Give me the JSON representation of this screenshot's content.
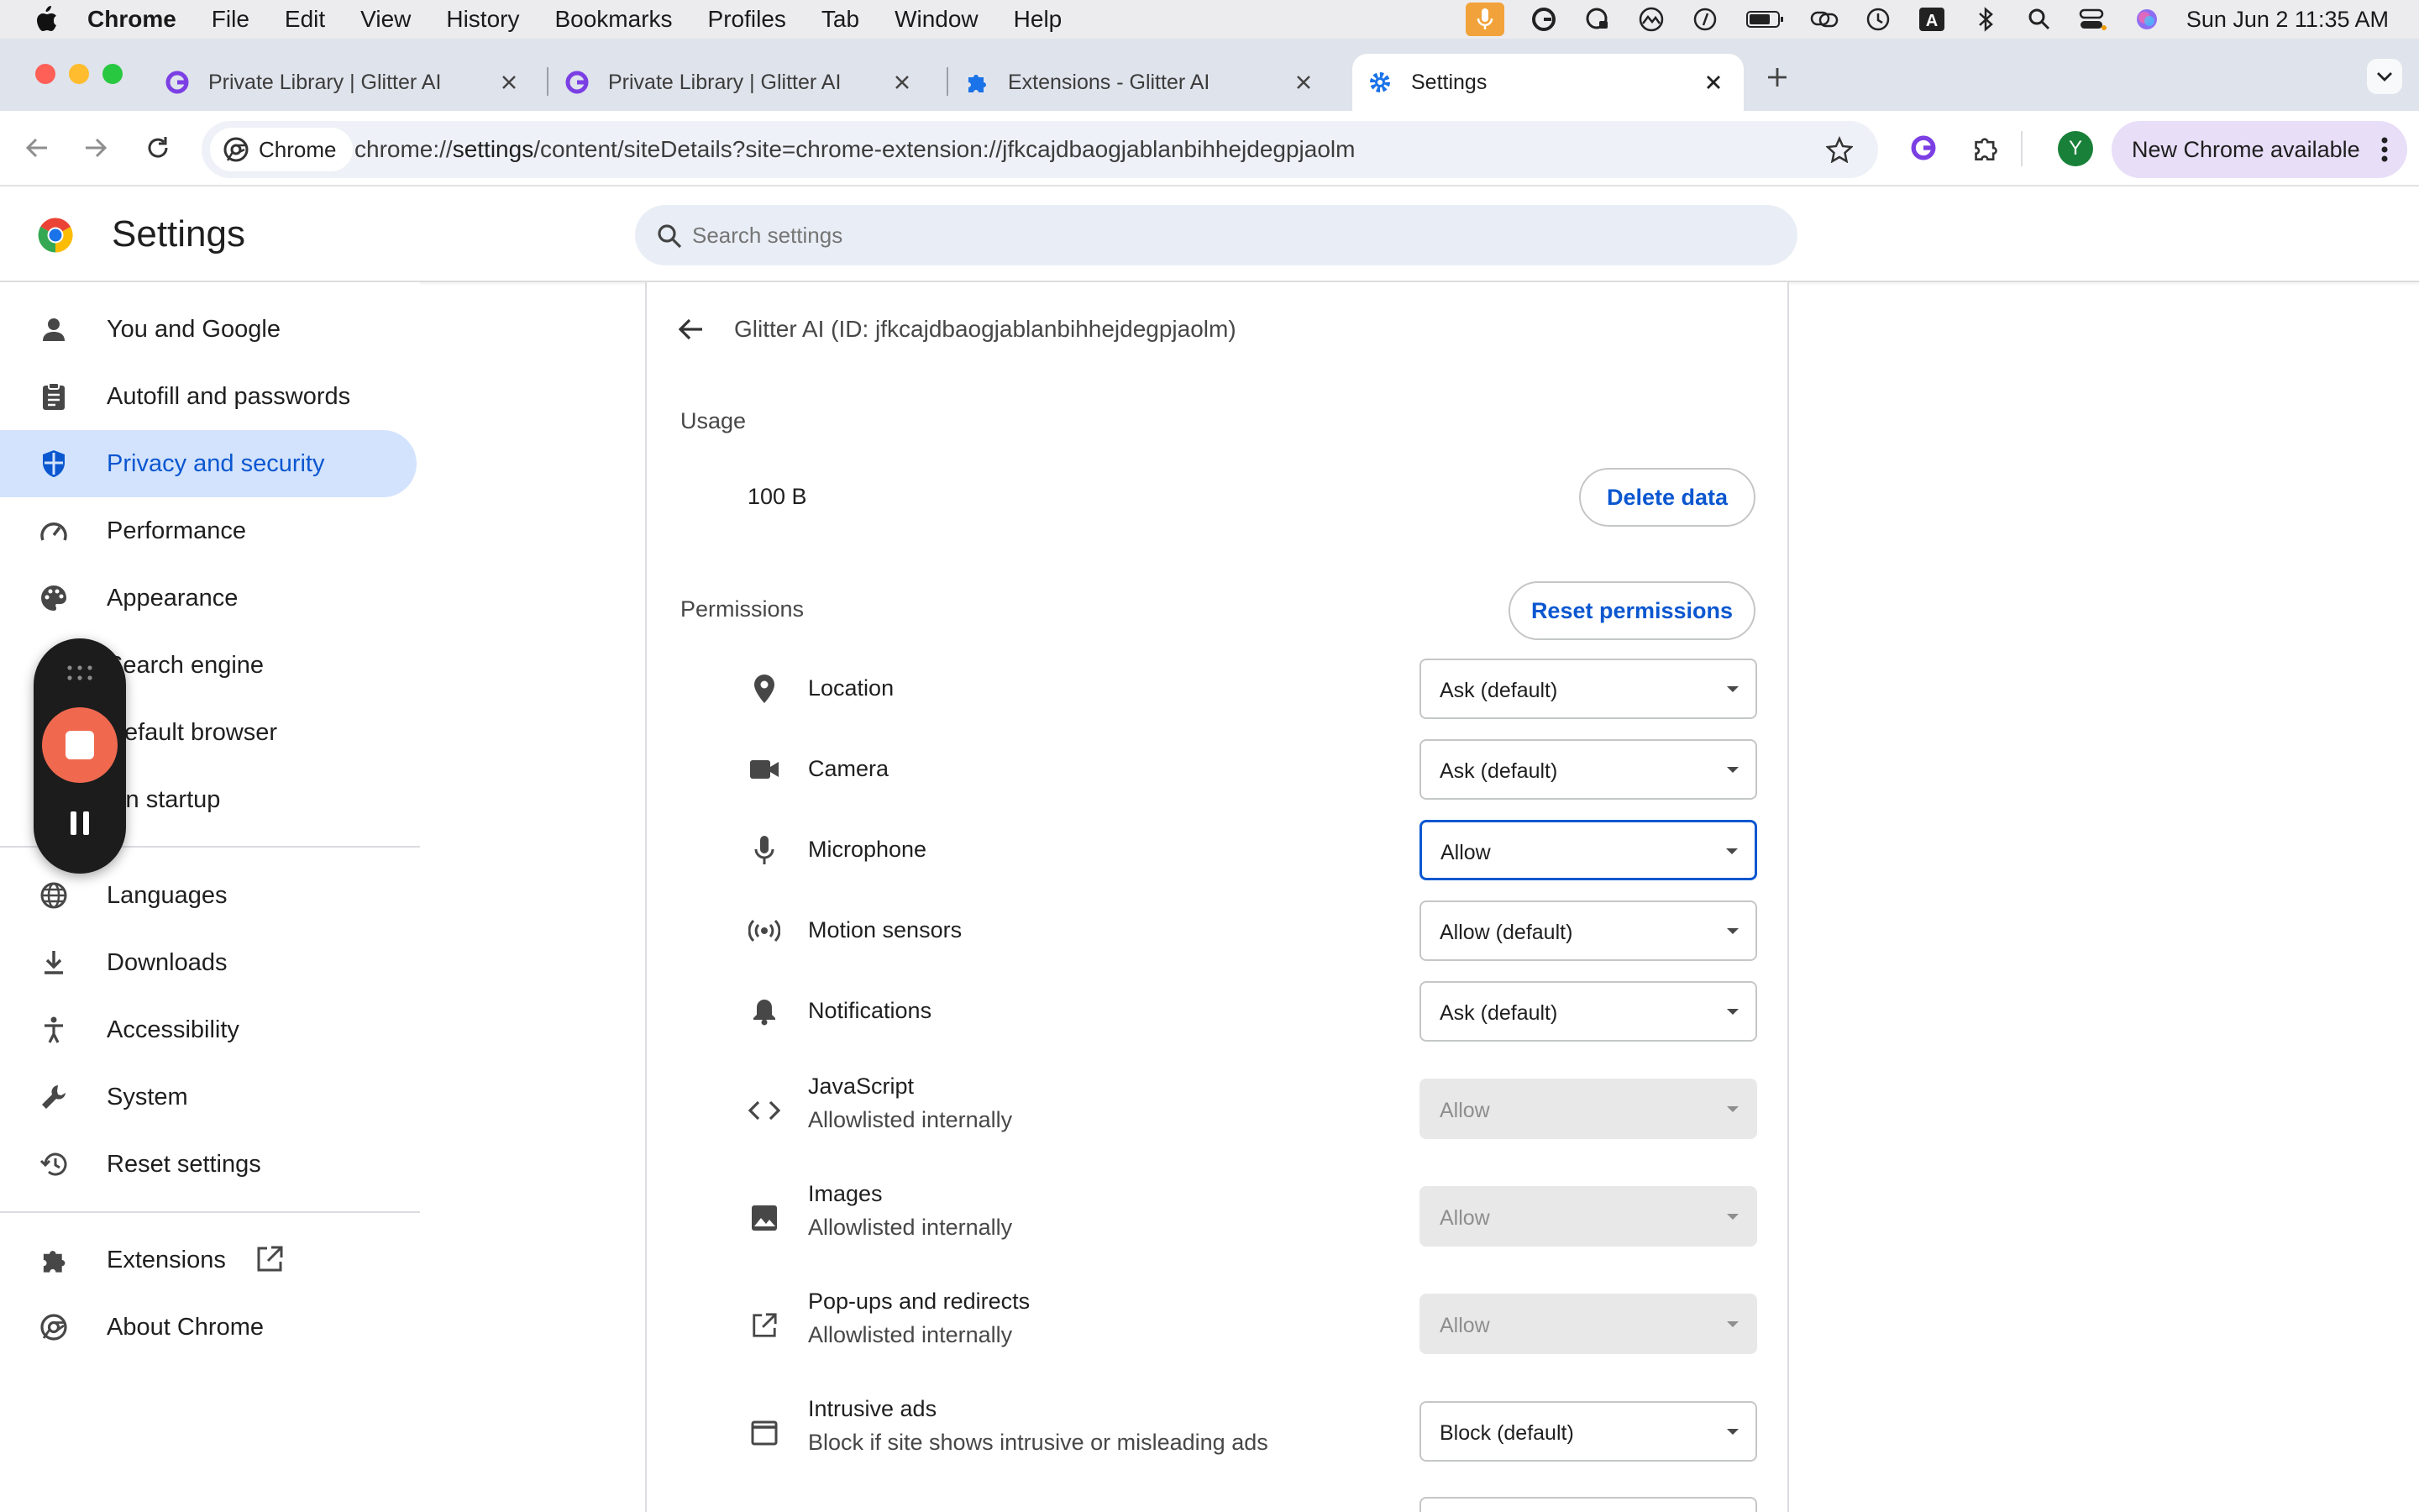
{
  "menubar": {
    "app_name": "Chrome",
    "items": [
      "File",
      "Edit",
      "View",
      "History",
      "Bookmarks",
      "Profiles",
      "Tab",
      "Window",
      "Help"
    ],
    "clock": "Sun Jun 2  11:35 AM"
  },
  "tabs": [
    {
      "title": "Private Library | Glitter AI",
      "icon": "glitter-icon"
    },
    {
      "title": "Private Library | Glitter AI",
      "icon": "glitter-icon"
    },
    {
      "title": "Extensions - Glitter AI",
      "icon": "puzzle-icon"
    },
    {
      "title": "Settings",
      "icon": "gear-icon",
      "active": true
    }
  ],
  "toolbar": {
    "chip_label": "Chrome",
    "url_prefix": "chrome://",
    "url_host": "settings",
    "url_path": "/content/siteDetails?site=chrome-extension://jfkcajdbaogjablanbihhejdegpjaolm",
    "profile_initial": "Y",
    "new_chrome_label": "New Chrome available"
  },
  "header": {
    "title": "Settings",
    "search_placeholder": "Search settings"
  },
  "sidebar": {
    "items": [
      {
        "label": "You and Google",
        "icon": "person-icon"
      },
      {
        "label": "Autofill and passwords",
        "icon": "clipboard-icon"
      },
      {
        "label": "Privacy and security",
        "icon": "shield-icon",
        "active": true
      },
      {
        "label": "Performance",
        "icon": "speedometer-icon"
      },
      {
        "label": "Appearance",
        "icon": "palette-icon"
      },
      {
        "label": "Search engine",
        "icon": "search-icon"
      },
      {
        "label": "Default browser",
        "icon": "browser-icon"
      },
      {
        "label": "On startup",
        "icon": "power-icon"
      },
      {
        "label": "Languages",
        "icon": "globe-icon"
      },
      {
        "label": "Downloads",
        "icon": "download-icon"
      },
      {
        "label": "Accessibility",
        "icon": "accessibility-icon"
      },
      {
        "label": "System",
        "icon": "wrench-icon"
      },
      {
        "label": "Reset settings",
        "icon": "history-icon"
      },
      {
        "label": "Extensions",
        "icon": "puzzle-icon"
      },
      {
        "label": "About Chrome",
        "icon": "chrome-icon"
      }
    ]
  },
  "site": {
    "title": "Glitter AI (ID: jfkcajdbaogjablanbihhejdegpjaolm)",
    "usage_label": "Usage",
    "usage_value": "100 B",
    "delete_button": "Delete data",
    "permissions_label": "Permissions",
    "reset_button": "Reset permissions"
  },
  "permissions": [
    {
      "name": "Location",
      "sub": "",
      "value": "Ask (default)",
      "icon": "location-pin-icon"
    },
    {
      "name": "Camera",
      "sub": "",
      "value": "Ask (default)",
      "icon": "camera-icon"
    },
    {
      "name": "Microphone",
      "sub": "",
      "value": "Allow",
      "icon": "microphone-icon",
      "focused": true
    },
    {
      "name": "Motion sensors",
      "sub": "",
      "value": "Allow (default)",
      "icon": "sensors-icon"
    },
    {
      "name": "Notifications",
      "sub": "",
      "value": "Ask (default)",
      "icon": "bell-icon"
    },
    {
      "name": "JavaScript",
      "sub": "Allowlisted internally",
      "value": "Allow",
      "icon": "code-icon",
      "disabled": true
    },
    {
      "name": "Images",
      "sub": "Allowlisted internally",
      "value": "Allow",
      "icon": "image-icon",
      "disabled": true
    },
    {
      "name": "Pop-ups and redirects",
      "sub": "Allowlisted internally",
      "value": "Allow",
      "icon": "open-in-new-icon",
      "disabled": true
    },
    {
      "name": "Intrusive ads",
      "sub": "Block if site shows intrusive or misleading ads",
      "value": "Block (default)",
      "icon": "window-icon"
    }
  ],
  "colors": {
    "accent": "#0b57d0",
    "active_nav_bg": "#d3e3fd",
    "recorder_stop": "#f0694f",
    "new_chrome_bg": "#e8def8"
  }
}
